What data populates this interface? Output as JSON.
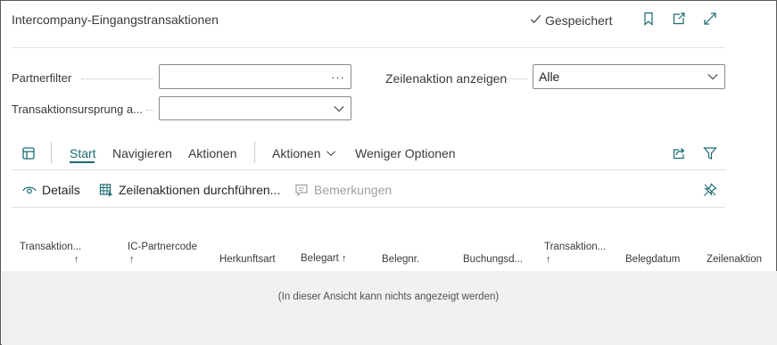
{
  "page": {
    "title": "Intercompany-Eingangstransaktionen",
    "saved_status": "Gespeichert"
  },
  "filters": {
    "partner_filter": {
      "label": "Partnerfilter",
      "value": "",
      "button": "···"
    },
    "transaction_source": {
      "label": "Transaktionsursprung a...",
      "value": ""
    },
    "line_action": {
      "label": "Zeilenaktion anzeigen",
      "value": "Alle"
    }
  },
  "menu": {
    "items": [
      "Start",
      "Navigieren",
      "Aktionen"
    ],
    "dropdown": "Aktionen",
    "fewer_options": "Weniger Optionen"
  },
  "actions": {
    "details": "Details",
    "perform_line_actions": "Zeilenaktionen durchführen...",
    "comments": "Bemerkungen"
  },
  "table": {
    "columns": [
      {
        "label": "Transaktion...",
        "sort": "↑"
      },
      {
        "label": "IC-Partnercode",
        "sort": "↑"
      },
      {
        "label": "Herkunftsart",
        "sort": ""
      },
      {
        "label": "Belegart",
        "sort": "↑"
      },
      {
        "label": "Belegnr.",
        "sort": ""
      },
      {
        "label": "Buchungsd...",
        "sort": ""
      },
      {
        "label": "Transaktion...",
        "sort": "↑"
      },
      {
        "label": "Belegdatum",
        "sort": ""
      },
      {
        "label": "Zeilenaktion",
        "sort": ""
      }
    ],
    "empty_message": "(In dieser Ansicht kann nichts angezeigt werden)"
  },
  "icons": {
    "saved": "check-icon",
    "bookmark": "bookmark-icon",
    "open_new": "open-in-new-window-icon",
    "expand": "expand-icon",
    "layout": "page-layout-icon",
    "share": "share-icon",
    "filter": "filter-icon",
    "details": "eye-icon",
    "perform": "table-action-icon",
    "comments": "comment-icon",
    "pin": "pin-icon"
  },
  "colors": {
    "accent": "#1a6b72",
    "empty_area": "#f0f1f3",
    "disabled_text": "#a0a0a0"
  }
}
